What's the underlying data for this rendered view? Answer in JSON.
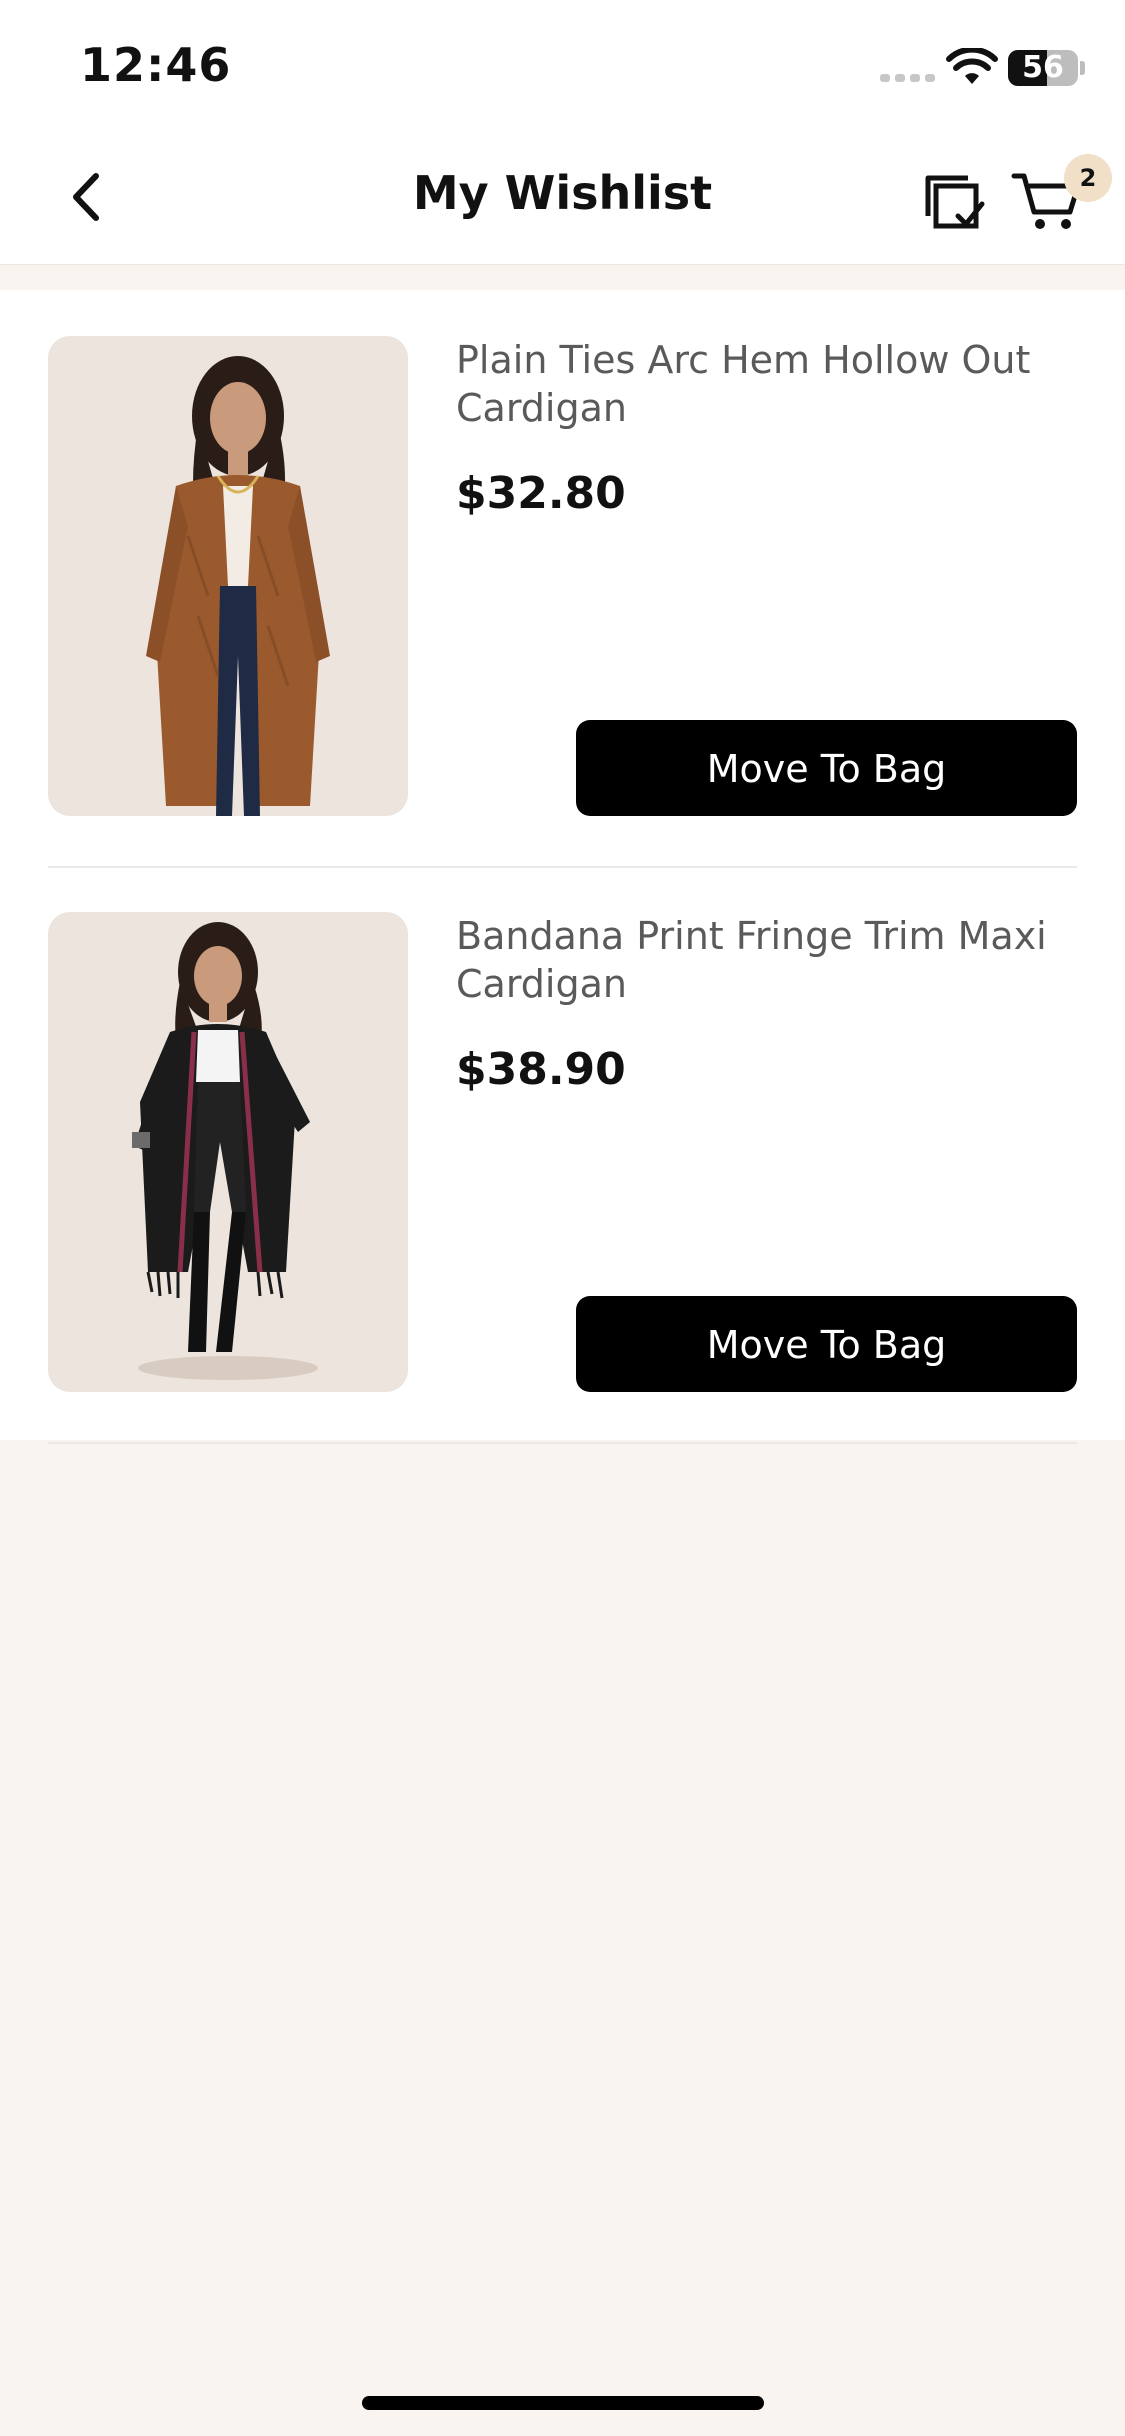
{
  "status_bar": {
    "time": "12:46",
    "battery": "56",
    "battery_level_percent": 56
  },
  "header": {
    "title": "My Wishlist",
    "back_icon": "chevron-left-icon",
    "manage_icon": "multi-select-check-icon",
    "cart_icon": "shopping-cart-icon",
    "cart_count": "2"
  },
  "wishlist": {
    "items": [
      {
        "name": "Plain Ties Arc Hem Hollow Out Cardigan",
        "price": "$32.80",
        "button_label": "Move To Bag",
        "image_colors": {
          "background": "#ece4dd",
          "garment": "#9a5a2e",
          "pants": "#1f2a44",
          "top": "#f3ece5"
        }
      },
      {
        "name": "Bandana Print Fringe Trim Maxi Cardigan",
        "price": "$38.90",
        "button_label": "Move To Bag",
        "image_colors": {
          "background": "#ece4dd",
          "garment": "#1b1b1b",
          "pants": "#222222",
          "top": "#f4f4f4",
          "accent": "#8a2f4a"
        }
      }
    ]
  },
  "colors": {
    "page_background": "#f9f4ef",
    "button": "#000000",
    "badge": "#f1dfc8"
  }
}
